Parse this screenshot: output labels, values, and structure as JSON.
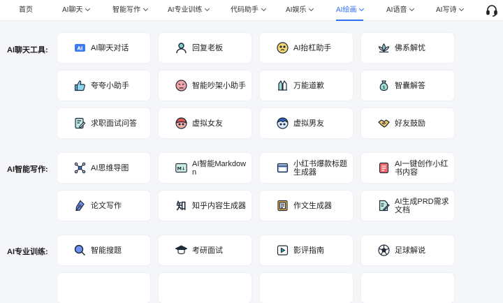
{
  "nav": {
    "items": [
      {
        "label": "首页",
        "chevron": false,
        "active": false
      },
      {
        "label": "AI聊天",
        "chevron": true,
        "active": false
      },
      {
        "label": "智能写作",
        "chevron": true,
        "active": false
      },
      {
        "label": "AI专业训练",
        "chevron": true,
        "active": false
      },
      {
        "label": "代码助手",
        "chevron": true,
        "active": false
      },
      {
        "label": "AI娱乐",
        "chevron": true,
        "active": false
      },
      {
        "label": "AI绘画",
        "chevron": true,
        "active": true
      },
      {
        "label": "AI语音",
        "chevron": true,
        "active": false
      },
      {
        "label": "AI写诗",
        "chevron": true,
        "active": false
      }
    ],
    "right_icon": "headset-icon",
    "accent_color": "#2f6ff4"
  },
  "sections": [
    {
      "label": "AI聊天工具:",
      "cards": [
        {
          "label": "AI聊天对话",
          "icon": "ai-chat-icon"
        },
        {
          "label": "回复老板",
          "icon": "person-icon"
        },
        {
          "label": "AI抬杠助手",
          "icon": "argue-face-icon"
        },
        {
          "label": "佛系解忧",
          "icon": "lotus-icon"
        },
        {
          "label": "夸夸小助手",
          "icon": "thumbs-up-icon"
        },
        {
          "label": "智能吵架小助手",
          "icon": "angry-face-icon"
        },
        {
          "label": "万能道歉",
          "icon": "apology-icon"
        },
        {
          "label": "智囊解答",
          "icon": "money-bag-icon"
        },
        {
          "label": "求职面试问答",
          "icon": "resume-icon"
        },
        {
          "label": "虚拟女友",
          "icon": "girl-avatar-icon"
        },
        {
          "label": "虚拟男友",
          "icon": "boy-avatar-icon"
        },
        {
          "label": "好友鼓励",
          "icon": "handshake-icon"
        }
      ]
    },
    {
      "label": "AI智能写作:",
      "cards": [
        {
          "label": "AI思维导图",
          "icon": "mind-map-icon"
        },
        {
          "label": "AI智能Markdown",
          "icon": "markdown-icon"
        },
        {
          "label": "小红书爆款标题生成器",
          "icon": "window-icon"
        },
        {
          "label": "AI一键创作小红书内容",
          "icon": "red-note-icon"
        },
        {
          "label": "论文写作",
          "icon": "pen-nib-icon"
        },
        {
          "label": "知乎内容生成器",
          "icon": "zhihu-icon"
        },
        {
          "label": "作文生成器",
          "icon": "essay-icon"
        },
        {
          "label": "AI生成PRD需求文档",
          "icon": "doc-edit-icon"
        }
      ]
    },
    {
      "label": "AI专业训练:",
      "cards": [
        {
          "label": "智能搜题",
          "icon": "search-icon"
        },
        {
          "label": "考研面试",
          "icon": "grad-cap-icon"
        },
        {
          "label": "影评指南",
          "icon": "play-icon"
        },
        {
          "label": "足球解说",
          "icon": "football-icon"
        }
      ]
    }
  ]
}
